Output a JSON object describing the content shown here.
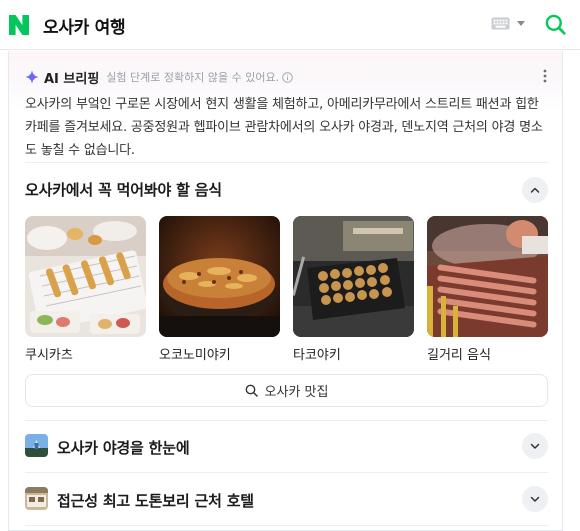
{
  "header": {
    "query": "오사카 여행"
  },
  "ai_briefing": {
    "title": "AI 브리핑",
    "note": "실험 단계로 정확하지 않을 수 있어요.",
    "summary": "오사카의 부엌인 구로몬 시장에서 현지 생활을 체험하고, 아메리카무라에서 스트리트 패션과 힙한 카페를 즐겨보세요. 공중정원과 헵파이브 관람차에서의 오사카 야경과, 덴노지역 근처의 야경 명소도 놓칠 수 없습니다."
  },
  "food_section": {
    "title": "오사카에서 꼭 먹어봐야 할 음식",
    "items": [
      {
        "label": "쿠시카츠"
      },
      {
        "label": "오코노미야키"
      },
      {
        "label": "타코야키"
      },
      {
        "label": "길거리 음식"
      }
    ],
    "more_search_label": "오사카 맛집"
  },
  "collapsed_sections": [
    {
      "title": "오사카 야경을 한눈에"
    },
    {
      "title": "접근성 최고 도톤보리 근처 호텔"
    }
  ],
  "colors": {
    "brand_green": "#03c75a",
    "ai_icon": "#6a5cff"
  }
}
